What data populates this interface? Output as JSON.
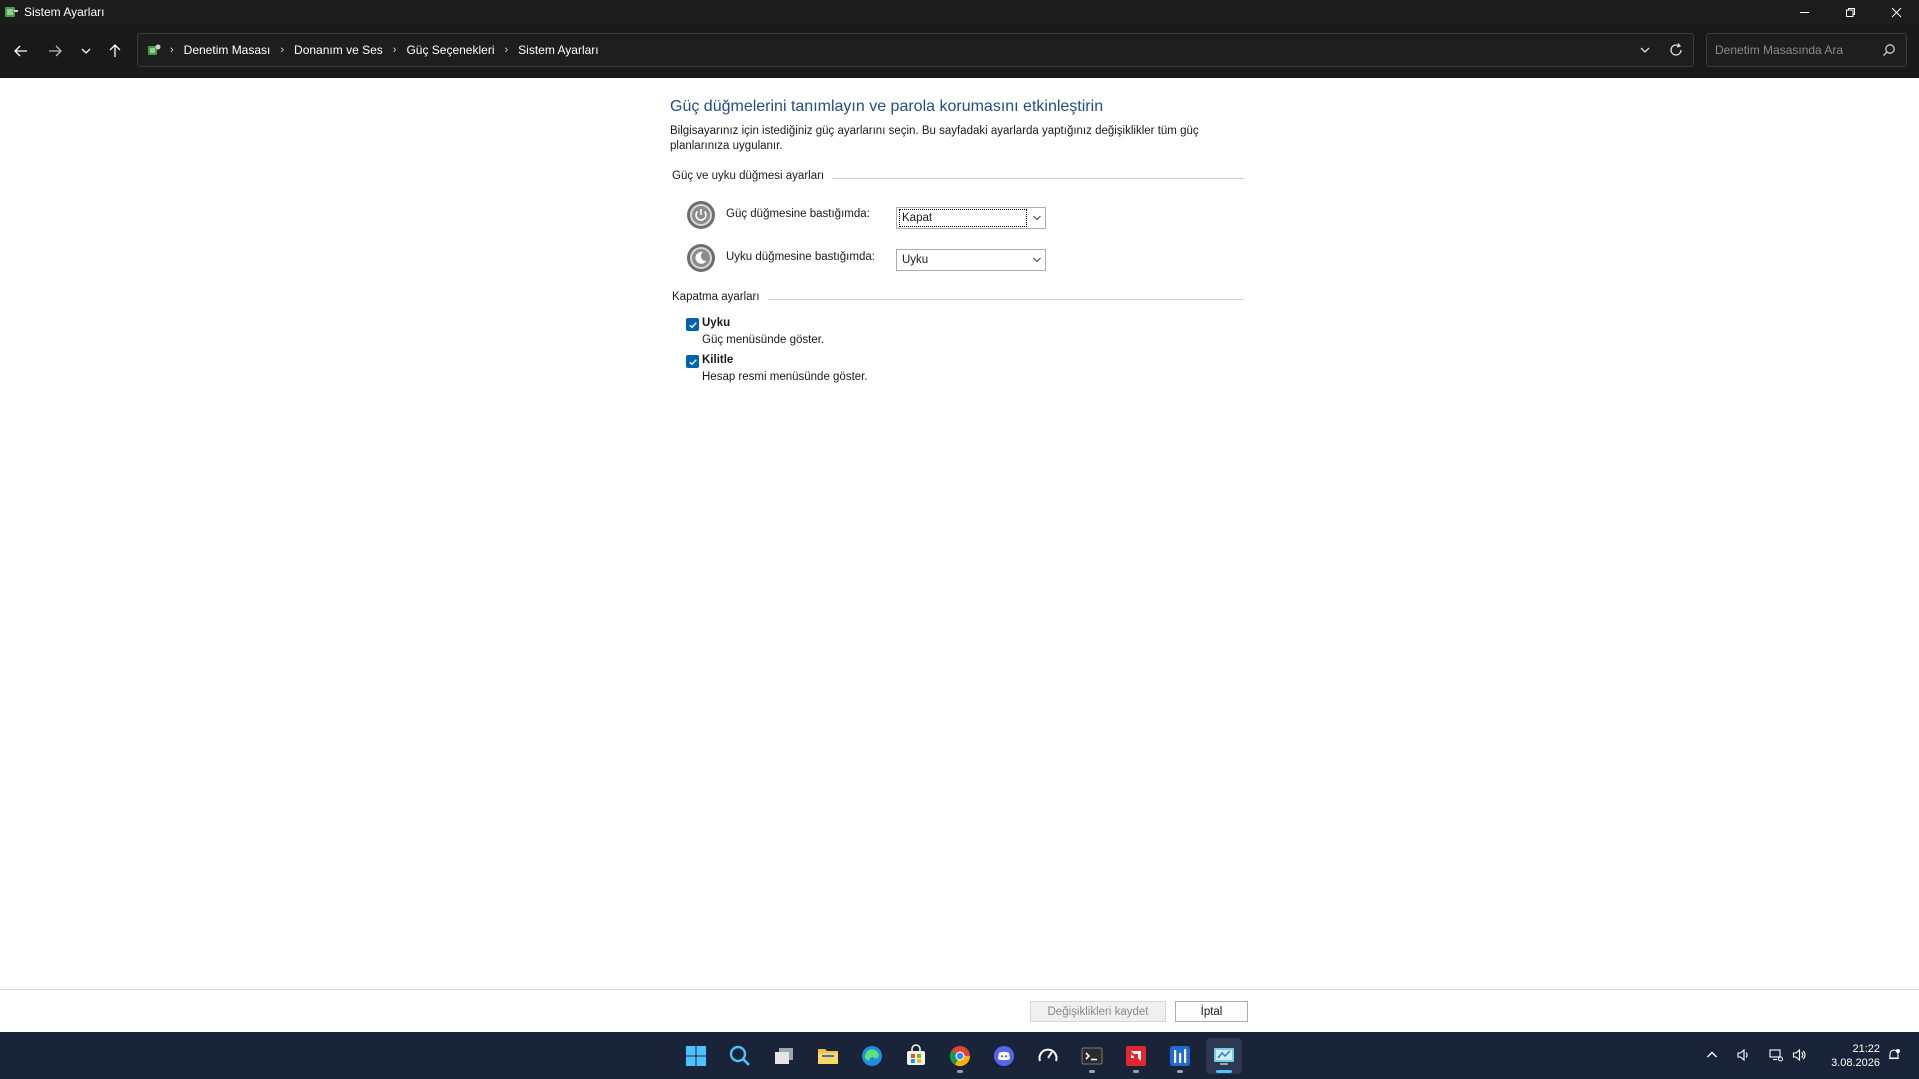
{
  "window": {
    "title": "Sistem Ayarları"
  },
  "address": {
    "crumbs": [
      "Denetim Masası",
      "Donanım ve Ses",
      "Güç Seçenekleri",
      "Sistem Ayarları"
    ],
    "search_placeholder": "Denetim Masasında Ara"
  },
  "page": {
    "heading": "Güç düğmelerini tanımlayın ve parola korumasını etkinleştirin",
    "description": "Bilgisayarınız için istediğiniz güç ayarlarını seçin. Bu sayfadaki ayarlarda yaptığınız değişiklikler tüm güç planlarınıza uygulanır.",
    "buttons_section": {
      "title": "Güç ve uyku düğmesi ayarları",
      "power_label": "Güç düğmesine bastığımda:",
      "power_value": "Kapat",
      "sleep_label": "Uyku düğmesine bastığımda:",
      "sleep_value": "Uyku"
    },
    "shutdown_section": {
      "title": "Kapatma ayarları",
      "options": [
        {
          "label": "Uyku",
          "sub": "Güç menüsünde göster.",
          "checked": true
        },
        {
          "label": "Kilitle",
          "sub": "Hesap resmi menüsünde göster.",
          "checked": true
        }
      ]
    }
  },
  "footer": {
    "save_label": "Değişiklikleri kaydet",
    "cancel_label": "İptal"
  },
  "taskbar": {
    "time": "21:22",
    "date": "3.08.2026"
  },
  "colors": {
    "accent": "#0063b1",
    "heading": "#1f4e8c",
    "taskbar": "#1a2438"
  }
}
